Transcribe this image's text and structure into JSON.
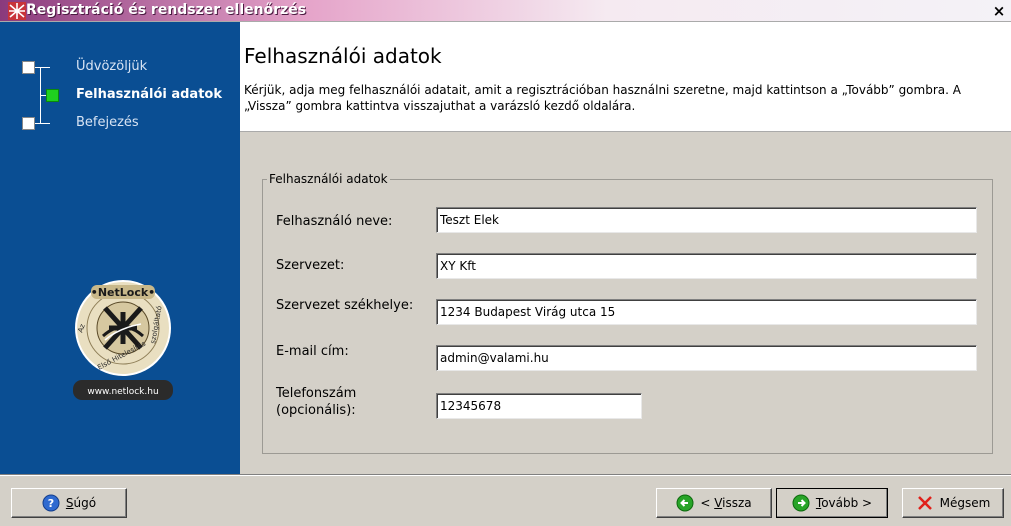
{
  "window": {
    "title": "Regisztráció és rendszer ellenőrzés",
    "close_glyph": "×",
    "icon": "netlock-app-icon"
  },
  "sidebar": {
    "steps": [
      {
        "label": "Üdvözöljük",
        "active": false
      },
      {
        "label": "Felhasználói adatok",
        "active": true
      },
      {
        "label": "Befejezés",
        "active": false
      }
    ],
    "logo": {
      "brand_text": "NetLock",
      "ring_text": "Az Első Hitelesítés-szolgáltató",
      "url_text": "www.netlock.hu"
    },
    "background_color": "#0a4e93",
    "active_step_color": "#1fd11f"
  },
  "header": {
    "title": "Felhasználói adatok",
    "description": "Kérjük, adja meg felhasználói adatait, amit a regisztrációban használni szeretne, majd kattintson a „Tovább” gombra. A „Vissza” gombra kattintva visszajuthat a varázsló kezdő oldalára."
  },
  "form": {
    "legend": "Felhasználói adatok",
    "fields": [
      {
        "label": "Felhasználó neve:",
        "value": "Teszt Elek"
      },
      {
        "label": "Szervezet:",
        "value": "XY Kft"
      },
      {
        "label": "Szervezet székhelye:",
        "value": "1234 Budapest Virág utca 15"
      },
      {
        "label": "E-mail cím:",
        "value": "admin@valami.hu"
      },
      {
        "label_line1": "Telefonszám",
        "label_line2": "(opcionális):",
        "value": "12345678"
      }
    ]
  },
  "buttons": {
    "help": {
      "underlined": "S",
      "rest": "úgó",
      "icon": "help-icon"
    },
    "back": {
      "prefix": "< ",
      "underlined": "V",
      "rest": "issza",
      "icon": "back-arrow-icon"
    },
    "next": {
      "underlined": "T",
      "rest": "ovább >",
      "icon": "next-arrow-icon"
    },
    "cancel": {
      "label": "Mégsem",
      "icon": "cancel-x-icon"
    }
  }
}
